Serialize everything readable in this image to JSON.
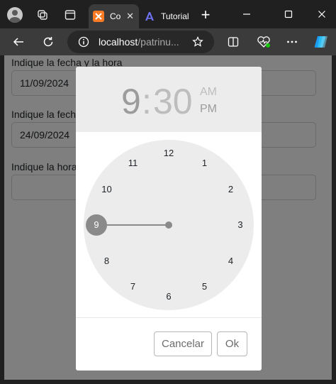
{
  "browser": {
    "tabs": [
      {
        "label": "Co",
        "active": true,
        "favicon": "xampp-icon"
      },
      {
        "label": "Tutorial",
        "active": false,
        "favicon": "tutorial-site-icon"
      }
    ],
    "close_tab_glyph": "✕",
    "new_tab_glyph": "+",
    "address": {
      "host": "localhost",
      "path": "/patrinu..."
    }
  },
  "colors": {
    "browser_frame": "#202020",
    "active_tab": "#3b3b3b",
    "overlay": "rgba(0,0,0,0.5)",
    "dialog_header": "#ececec",
    "dial": "#ececec",
    "selected_hour": "#8a8a8a",
    "xampp_orange": "#fb7a24",
    "copilot_blue": "#1d9bf0"
  },
  "form": {
    "fields": [
      {
        "label": "Indique la fecha y la hora",
        "value": "11/09/2024"
      },
      {
        "label": "Indique la fecha y la hora",
        "value": "24/09/2024"
      },
      {
        "label": "Indique la hora",
        "value": ""
      }
    ]
  },
  "clock_picker": {
    "hour": "9",
    "separator": ":",
    "minute": "30",
    "am_label": "AM",
    "pm_label": "PM",
    "selected_period": "PM",
    "selected_hour": "9",
    "hours": [
      "12",
      "1",
      "2",
      "3",
      "4",
      "5",
      "6",
      "7",
      "8",
      "9",
      "10",
      "11"
    ],
    "cancel_label": "Cancelar",
    "ok_label": "Ok"
  }
}
